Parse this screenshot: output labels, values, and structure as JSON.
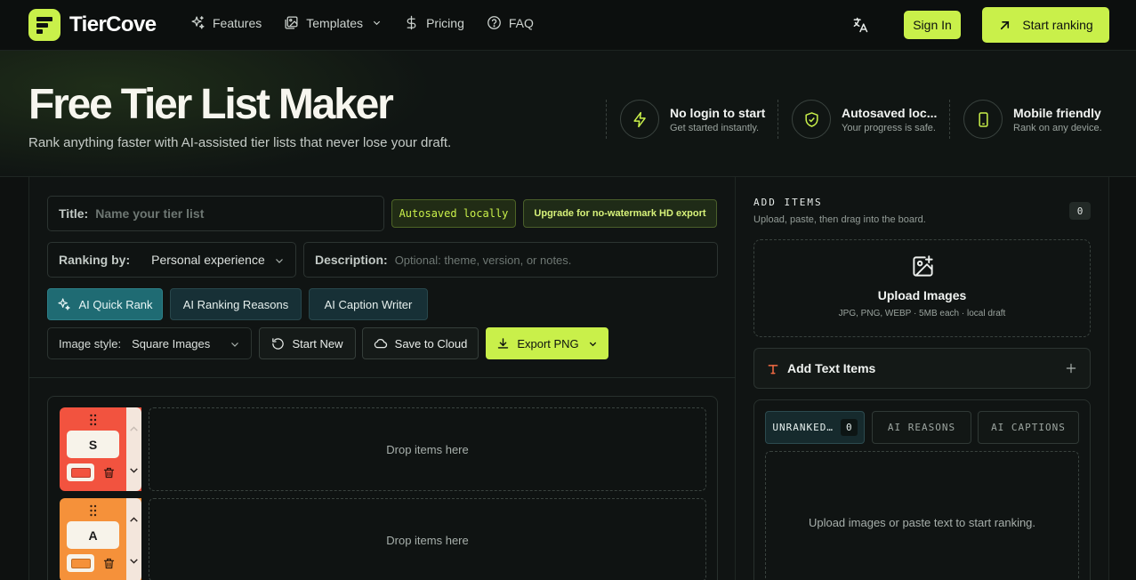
{
  "brand": {
    "name": "TierCove",
    "accent": "#c9f04a"
  },
  "nav": {
    "links": [
      {
        "label": "Features",
        "icon": "sparkles-icon"
      },
      {
        "label": "Templates",
        "icon": "images-icon"
      },
      {
        "label": "Pricing",
        "icon": "dollar-icon"
      },
      {
        "label": "FAQ",
        "icon": "help-circle-icon"
      }
    ],
    "sign_in": "Sign In",
    "start_ranking": "Start ranking"
  },
  "hero": {
    "title": "Free Tier List Maker",
    "subtitle": "Rank anything faster with AI-assisted tier lists that never lose your draft.",
    "features": [
      {
        "title": "No login to start",
        "sub": "Get started instantly.",
        "icon": "lightning-icon"
      },
      {
        "title": "Autosaved loc...",
        "sub": "Your progress is safe.",
        "icon": "shield-check-icon"
      },
      {
        "title": "Mobile friendly",
        "sub": "Rank on any device.",
        "icon": "phone-icon"
      }
    ]
  },
  "editor": {
    "title_label": "Title:",
    "title_placeholder": "Name your tier list",
    "autosaved_badge": "Autosaved locally",
    "upgrade_badge": "Upgrade for no-watermark HD export",
    "ranking_label": "Ranking by:",
    "ranking_value": "Personal experience",
    "description_label": "Description:",
    "description_placeholder": "Optional: theme, version, or notes.",
    "ai_buttons": [
      "AI Quick Rank",
      "AI Ranking Reasons",
      "AI Caption Writer"
    ],
    "image_style_label": "Image style:",
    "image_style_value": "Square Images",
    "start_new": "Start New",
    "save_cloud": "Save to Cloud",
    "export_png": "Export PNG"
  },
  "tiers": [
    {
      "name": "S",
      "color": "#f2533f",
      "drop_text": "Drop items here"
    },
    {
      "name": "A",
      "color": "#f5913a",
      "drop_text": "Drop items here"
    }
  ],
  "sidebar": {
    "add_items_title": "ADD ITEMS",
    "add_items_sub": "Upload, paste, then drag into the board.",
    "item_count": "0",
    "upload_title": "Upload Images",
    "upload_sub": "JPG, PNG, WEBP · 5MB each · local draft",
    "add_text_items": "Add Text Items",
    "tabs": [
      {
        "label": "UNRANKED…",
        "count": "0"
      },
      {
        "label": "AI REASONS"
      },
      {
        "label": "AI CAPTIONS"
      }
    ],
    "empty_text": "Upload images or paste text to start ranking."
  }
}
